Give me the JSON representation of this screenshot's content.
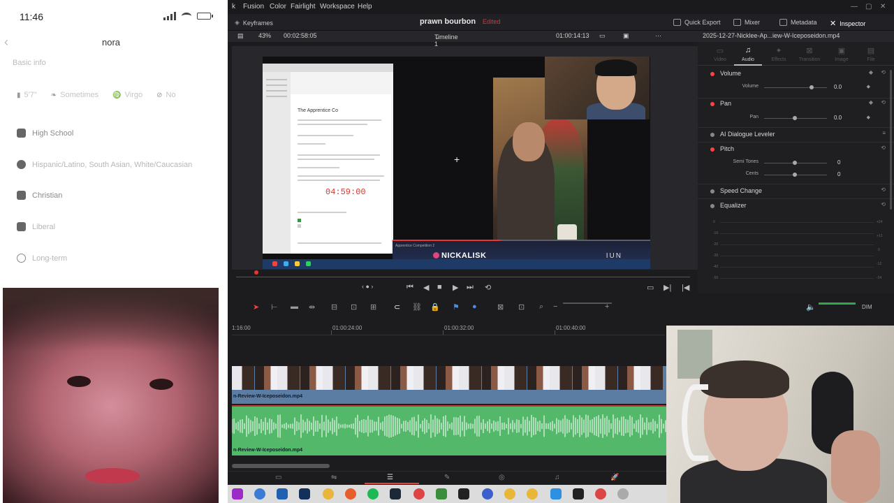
{
  "phone": {
    "time": "11:46",
    "profile_name": "nora",
    "section_title": "Basic info",
    "chips": [
      {
        "icon": "ruler-icon",
        "label": "5'7\""
      },
      {
        "icon": "wine-icon",
        "label": "Sometimes"
      },
      {
        "icon": "zodiac-icon",
        "label": "Virgo"
      },
      {
        "icon": "smoke-icon",
        "label": "No"
      }
    ],
    "rows": [
      {
        "icon": "graduation-cap-icon",
        "label": "High School"
      },
      {
        "icon": "globe-icon",
        "label": "Hispanic/Latino, South Asian, White/Caucasian"
      },
      {
        "icon": "book-icon",
        "label": "Christian"
      },
      {
        "icon": "politics-icon",
        "label": "Liberal"
      },
      {
        "icon": "search-icon",
        "label": "Long-term"
      }
    ]
  },
  "editor": {
    "menu": [
      "Fusion",
      "Color",
      "Fairlight",
      "Workspace",
      "Help"
    ],
    "menu_prefix": "k",
    "keyframes_label": "Keyframes",
    "project_title": "prawn bourbon",
    "project_status": "Edited",
    "top_buttons": [
      {
        "icon": "export-icon",
        "label": "Quick Export"
      },
      {
        "icon": "mixer-icon",
        "label": "Mixer"
      },
      {
        "icon": "metadata-icon",
        "label": "Metadata"
      },
      {
        "icon": "inspector-icon",
        "label": "Inspector"
      }
    ],
    "zoom": "43%",
    "source_timecode": "00:02:58:05",
    "timeline_name": "Timeline 1",
    "record_timecode": "01:00:14:13",
    "clip_name": "2025-12-27-Nicklee-Ap...iew-W-Iceposeidon.mp4",
    "viewer": {
      "doc_title": "The Apprentice Co",
      "doc_timer": "04:59:00",
      "stream_name": "NICKALISK",
      "stream_subtitle": "Apprentice Competition 2",
      "stream_logo": "IUN",
      "progress_fraction": 0.42
    },
    "ruler_labels": [
      "1:16:00",
      "01:00:24:00",
      "01:00:32:00",
      "01:00:40:00"
    ],
    "video_clip_label": "n-Review-W-Iceposeidon.mp4",
    "audio_clip_label": "n-Review-W-Iceposeidon.mp4",
    "dim_label": "DIM",
    "volume_level": 0.75
  },
  "inspector": {
    "tabs": [
      {
        "label": "Video",
        "icon": "video-icon",
        "active": false
      },
      {
        "label": "Audio",
        "icon": "music-note-icon",
        "active": true
      },
      {
        "label": "Effects",
        "icon": "effects-icon",
        "active": false
      },
      {
        "label": "Transition",
        "icon": "transition-icon",
        "active": false
      },
      {
        "label": "Image",
        "icon": "image-icon",
        "active": false
      },
      {
        "label": "File",
        "icon": "file-icon",
        "active": false
      }
    ],
    "volume": {
      "title": "Volume",
      "param": "Volume",
      "value": "0.0"
    },
    "pan": {
      "title": "Pan",
      "param": "Pan",
      "value": "0.0"
    },
    "ai_dialogue": {
      "title": "AI Dialogue Leveler"
    },
    "pitch": {
      "title": "Pitch",
      "semi_label": "Semi Tones",
      "semi_value": "0",
      "cents_label": "Cents",
      "cents_value": "0"
    },
    "speed_change": {
      "title": "Speed Change"
    },
    "equalizer": {
      "title": "Equalizer",
      "scale_left": [
        "0",
        "-10",
        "-20",
        "-30",
        "-40",
        "-50"
      ],
      "scale_right": [
        "+24",
        "+12",
        "0",
        "-12",
        "-24"
      ]
    }
  },
  "colors": {
    "accent_red": "#e2413a",
    "audio_green": "#54b86b",
    "video_blue": "#5c7da3"
  }
}
